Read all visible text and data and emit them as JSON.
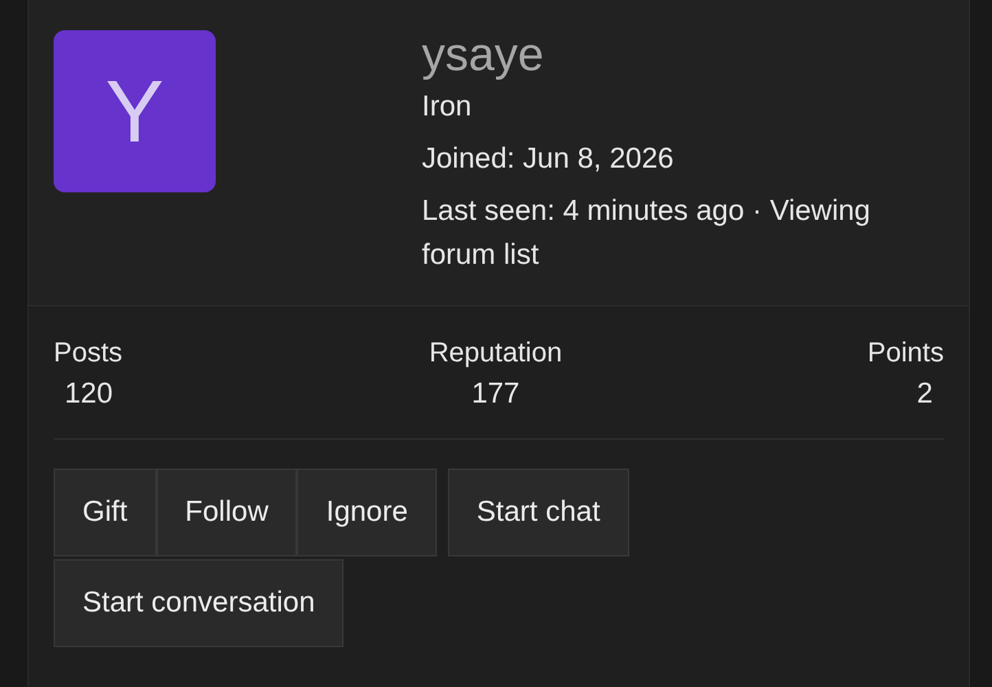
{
  "profile": {
    "avatar_letter": "Y",
    "username": "ysaye",
    "rank": "Iron",
    "joined": "Joined: Jun 8, 2026",
    "last_seen": "Last seen: 4 minutes ago · Viewing forum list"
  },
  "stats": [
    {
      "label": "Posts",
      "value": "120"
    },
    {
      "label": "Reputation",
      "value": "177"
    },
    {
      "label": "Points",
      "value": "2"
    }
  ],
  "button_groups": [
    [
      "Gift",
      "Follow",
      "Ignore"
    ],
    [
      "Start chat"
    ],
    [
      "Start conversation"
    ]
  ]
}
